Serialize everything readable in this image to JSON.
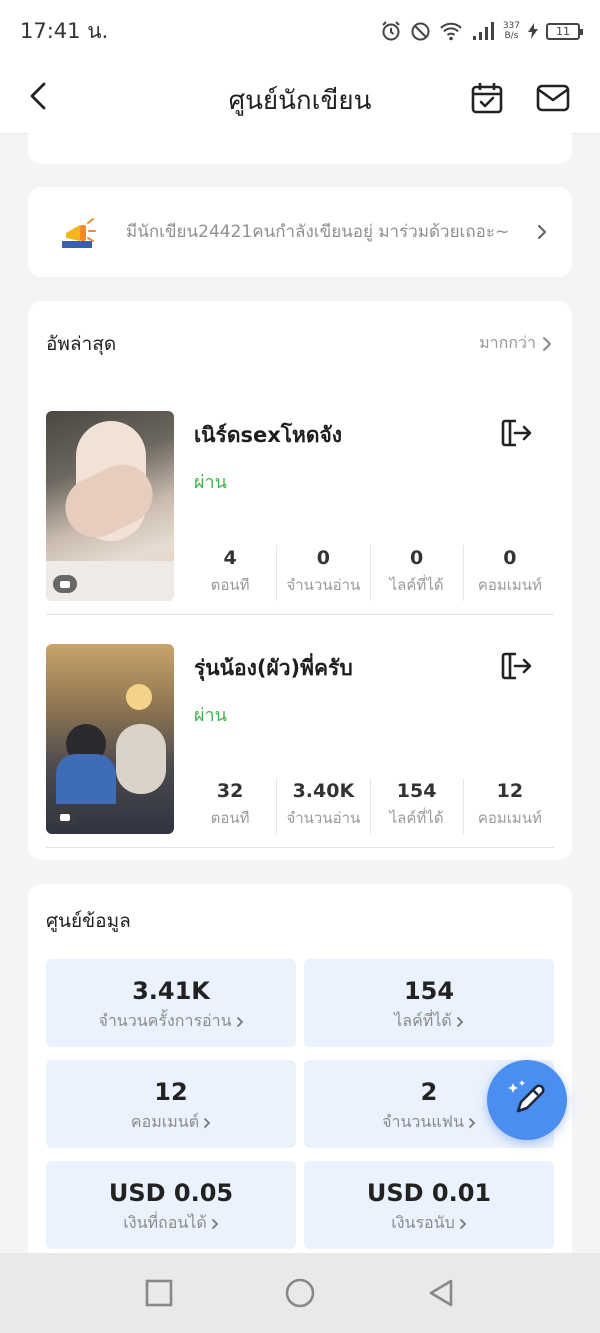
{
  "status_bar": {
    "time": "17:41 น.",
    "net_speed_value": "337",
    "net_speed_unit": "B/s",
    "battery": "11"
  },
  "header": {
    "title": "ศูนย์นักเขียน"
  },
  "banner": {
    "text": "มีนักเขียน24421คนกำลังเขียนอยู่ มาร่วมด้วยเถอะ~"
  },
  "updates": {
    "title": "อัพล่าสุด",
    "more_label": "มากกว่า",
    "stories": [
      {
        "title": "เนิร์ดsexโหดจัง",
        "status": "ผ่าน",
        "stats": [
          {
            "value": "4",
            "label": "ตอนที"
          },
          {
            "value": "0",
            "label": "จำนวนอ่าน"
          },
          {
            "value": "0",
            "label": "ไลค์ที่ได้"
          },
          {
            "value": "0",
            "label": "คอมเมนท์"
          }
        ]
      },
      {
        "title": "รุ่นน้อง(ผัว)พี่ครับ",
        "status": "ผ่าน",
        "stats": [
          {
            "value": "32",
            "label": "ตอนที"
          },
          {
            "value": "3.40K",
            "label": "จำนวนอ่าน"
          },
          {
            "value": "154",
            "label": "ไลค์ที่ได้"
          },
          {
            "value": "12",
            "label": "คอมเมนท์"
          }
        ]
      }
    ]
  },
  "datacenter": {
    "title": "ศูนย์ข้อมูล",
    "tiles": [
      {
        "value": "3.41K",
        "label": "จำนวนครั้งการอ่าน"
      },
      {
        "value": "154",
        "label": "ไลค์ที่ได้"
      },
      {
        "value": "12",
        "label": "คอมเมนต์"
      },
      {
        "value": "2",
        "label": "จำนวนแฟน"
      },
      {
        "value": "USD 0.05",
        "label": "เงินที่ถอนได้"
      },
      {
        "value": "USD 0.01",
        "label": "เงินรอนับ"
      }
    ]
  },
  "colors": {
    "accent": "#4a8ff0",
    "status_pass": "#3cb54a",
    "tile_bg": "#eaf2fd"
  }
}
